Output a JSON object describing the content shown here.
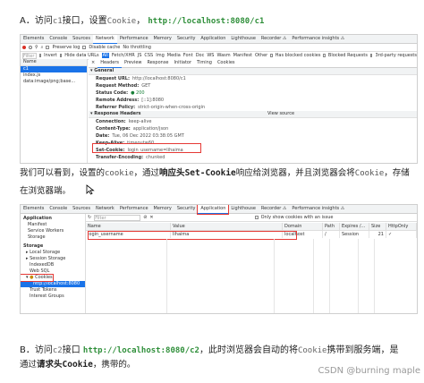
{
  "section_a": {
    "prefix": "A．访问",
    "path": "c1",
    "middle": "接口，设置",
    "word": "Cookie",
    "sep": "，",
    "url": "http://localhost:8080/c1"
  },
  "dt1": {
    "tabs": [
      "Elements",
      "Console",
      "Sources",
      "Network",
      "Performance",
      "Memory",
      "Security",
      "Application",
      "Lighthouse",
      "Recorder ⚠",
      "Performance insights ⚠"
    ],
    "active_tab": "Network",
    "toolbar": [
      "Preserve log",
      "Disable cache",
      "No throttling"
    ],
    "filter_placeholder": "Filter",
    "filter_types": [
      "Invert",
      "Hide data URLs",
      "All",
      "Fetch/XHR",
      "JS",
      "CSS",
      "Img",
      "Media",
      "Font",
      "Doc",
      "WS",
      "Wasm",
      "Manifest",
      "Other",
      "Has blocked cookies",
      "Blocked Requests",
      "3rd-party requests"
    ],
    "columns_header": "Name",
    "requests": [
      "c1",
      "index.js",
      "data:image/png;base..."
    ],
    "detail_tabs": [
      "×",
      "Headers",
      "Preview",
      "Response",
      "Initiator",
      "Timing",
      "Cookies"
    ],
    "general_title": "▾ General",
    "general": [
      {
        "k": "Request URL:",
        "v": "http://localhost:8080/c1"
      },
      {
        "k": "Request Method:",
        "v": "GET"
      },
      {
        "k": "Status Code:",
        "v": "● 200"
      },
      {
        "k": "Remote Address:",
        "v": "[::1]:8080"
      },
      {
        "k": "Referrer Policy:",
        "v": "strict-origin-when-cross-origin"
      }
    ],
    "response_title": "▾ Response Headers",
    "view_source": "View source",
    "response": [
      {
        "k": "Connection:",
        "v": "keep-alive"
      },
      {
        "k": "Content-Type:",
        "v": "application/json"
      },
      {
        "k": "Date:",
        "v": "Tue, 06 Dec 2022 03:38:05 GMT"
      },
      {
        "k": "Keep-Alive:",
        "v": "timeout=60"
      },
      {
        "k": "Set-Cookie:",
        "v": "login_username=lihaima"
      },
      {
        "k": "Transfer-Encoding:",
        "v": "chunked"
      }
    ]
  },
  "para1": {
    "t1": "我们可以看到，设置的",
    "m1": "cookie",
    "t2": "，通过",
    "b1": "响应头",
    "b2": "Set-Cookie",
    "t3": "响应给浏览器，并且浏览器会将",
    "m2": "Cookie",
    "t4": "，存储在浏览器端。"
  },
  "dt2": {
    "tabs": [
      "Elements",
      "Console",
      "Sources",
      "Network",
      "Performance",
      "Memory",
      "Security",
      "Application",
      "Lighthouse",
      "Recorder ⚠",
      "Performance insights ⚠"
    ],
    "active_tab": "Application",
    "filter_placeholder": "Filter",
    "only_issue": "Only show cookies with an issue",
    "app_title": "Application",
    "app_items": [
      "Manifest",
      "Service Workers",
      "Storage"
    ],
    "storage_title": "Storage",
    "storage_items": [
      "Local Storage",
      "Session Storage",
      "IndexedDB",
      "Web SQL",
      "Cookies",
      "http://localhost:8080",
      "Trust Tokens",
      "Interest Groups"
    ],
    "columns": [
      "Name",
      "Value",
      "Domain",
      "Path",
      "Expires /...",
      "Size",
      "HttpOnly"
    ],
    "cookie_row": [
      "login_username",
      "lihaima",
      "localhost",
      "/",
      "Session",
      "21",
      "✓"
    ]
  },
  "section_b": {
    "prefix": "B．访问",
    "path": "c2",
    "middle": "接口",
    "url": "http://localhost:8080/c2",
    "rest": "，此时浏览器会自动的将",
    "word": "Cookie",
    "rest2": "携带到服务端，是"
  },
  "para2": {
    "t1": "通过",
    "b1": "请求头",
    "b2": "Cookie",
    "t2": "，携带的。"
  },
  "watermark": "CSDN @burning maple"
}
